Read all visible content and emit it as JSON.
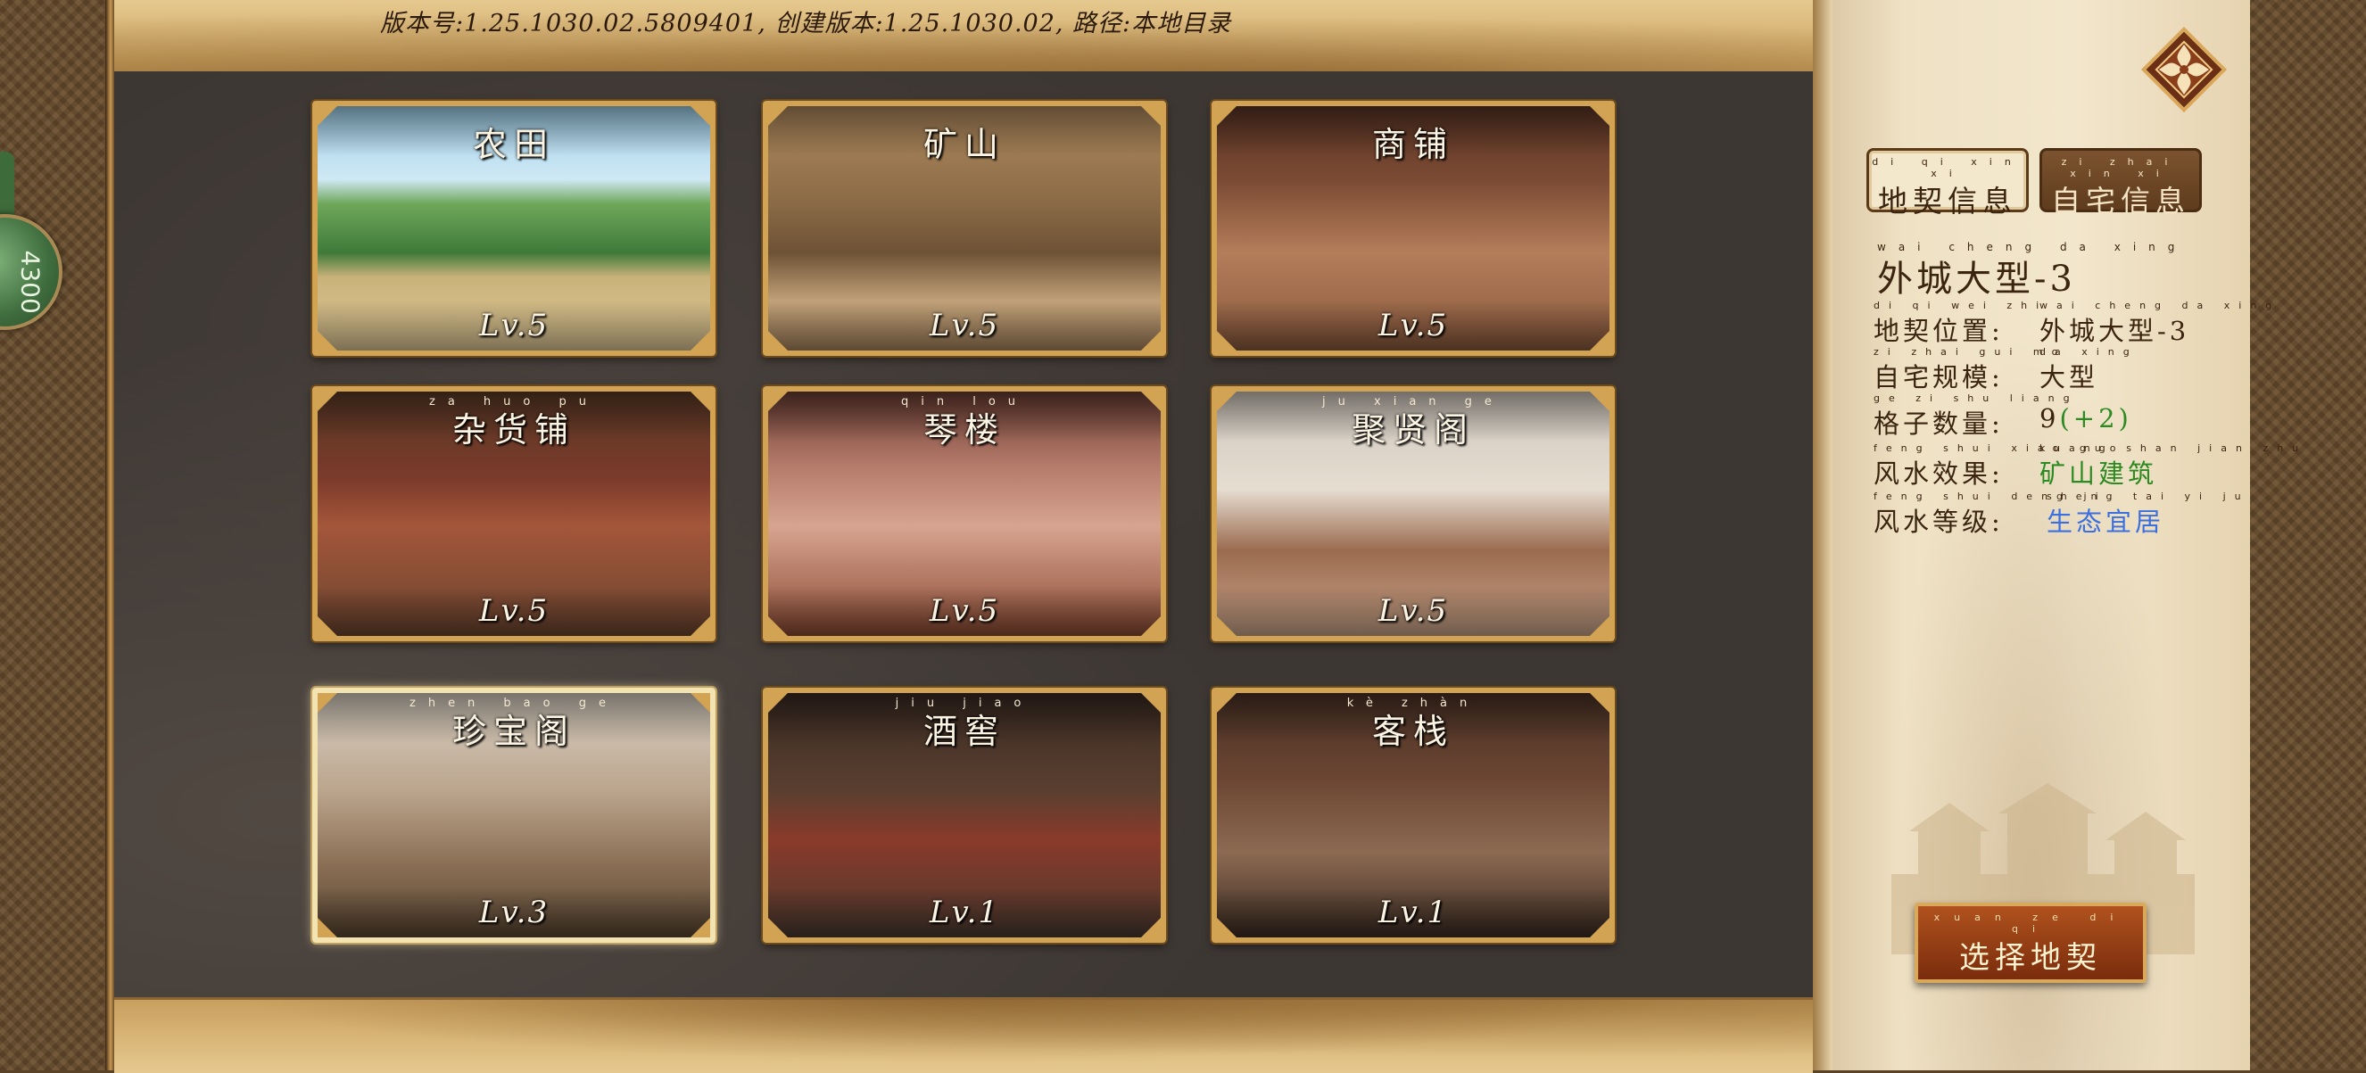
{
  "version_text": "版本号:1.25.1030.02.5809401, 创建版本:1.25.1030.02, 路径:本地目录",
  "side_badge": "4300",
  "properties": [
    {
      "pinyin": "",
      "name": "农田",
      "level": "Lv.5"
    },
    {
      "pinyin": "",
      "name": "矿山",
      "level": "Lv.5"
    },
    {
      "pinyin": "",
      "name": "商铺",
      "level": "Lv.5"
    },
    {
      "pinyin": "za huo pu",
      "name": "杂货铺",
      "level": "Lv.5"
    },
    {
      "pinyin": "qin lou",
      "name": "琴楼",
      "level": "Lv.5"
    },
    {
      "pinyin": "ju xian ge",
      "name": "聚贤阁",
      "level": "Lv.5"
    },
    {
      "pinyin": "zhen bao ge",
      "name": "珍宝阁",
      "level": "Lv.3"
    },
    {
      "pinyin": "jiu jiao",
      "name": "酒窖",
      "level": "Lv.1"
    },
    {
      "pinyin": "kè zhàn",
      "name": "客栈",
      "level": "Lv.1"
    }
  ],
  "tabs": [
    {
      "pinyin": "di qi xin xi",
      "label": "地契信息"
    },
    {
      "pinyin": "zi zhai xin xi",
      "label": "自宅信息"
    }
  ],
  "info": {
    "title_pinyin": "wai cheng da xing",
    "title": "外城大型-3",
    "rows": [
      {
        "pinyin": "di qi wei zhi",
        "label": "地契位置:",
        "value": "外城大型-3",
        "value_pinyin": "wai cheng da xing"
      },
      {
        "pinyin": "zi zhai gui mo",
        "label": "自宅规模:",
        "value": "大型",
        "value_pinyin": "da xing"
      },
      {
        "pinyin": "ge zi shu liang",
        "label": "格子数量:",
        "value": "9",
        "value_extra": "(+2)"
      },
      {
        "pinyin": "feng shui xiao guo",
        "label": "风水效果:",
        "value": "矿山建筑",
        "value_pinyin": "kuang shan jian zhu"
      },
      {
        "pinyin": "feng shui deng ji",
        "label": "风水等级:",
        "value": "生态宜居",
        "value_pinyin": "sheng tai yi ju"
      }
    ]
  },
  "select_button": {
    "pinyin": "xuan ze di qi",
    "label": "选择地契"
  },
  "colors": {
    "accent_gold": "#d1a352",
    "green": "#2c8a22",
    "blue": "#3a6fe0"
  }
}
